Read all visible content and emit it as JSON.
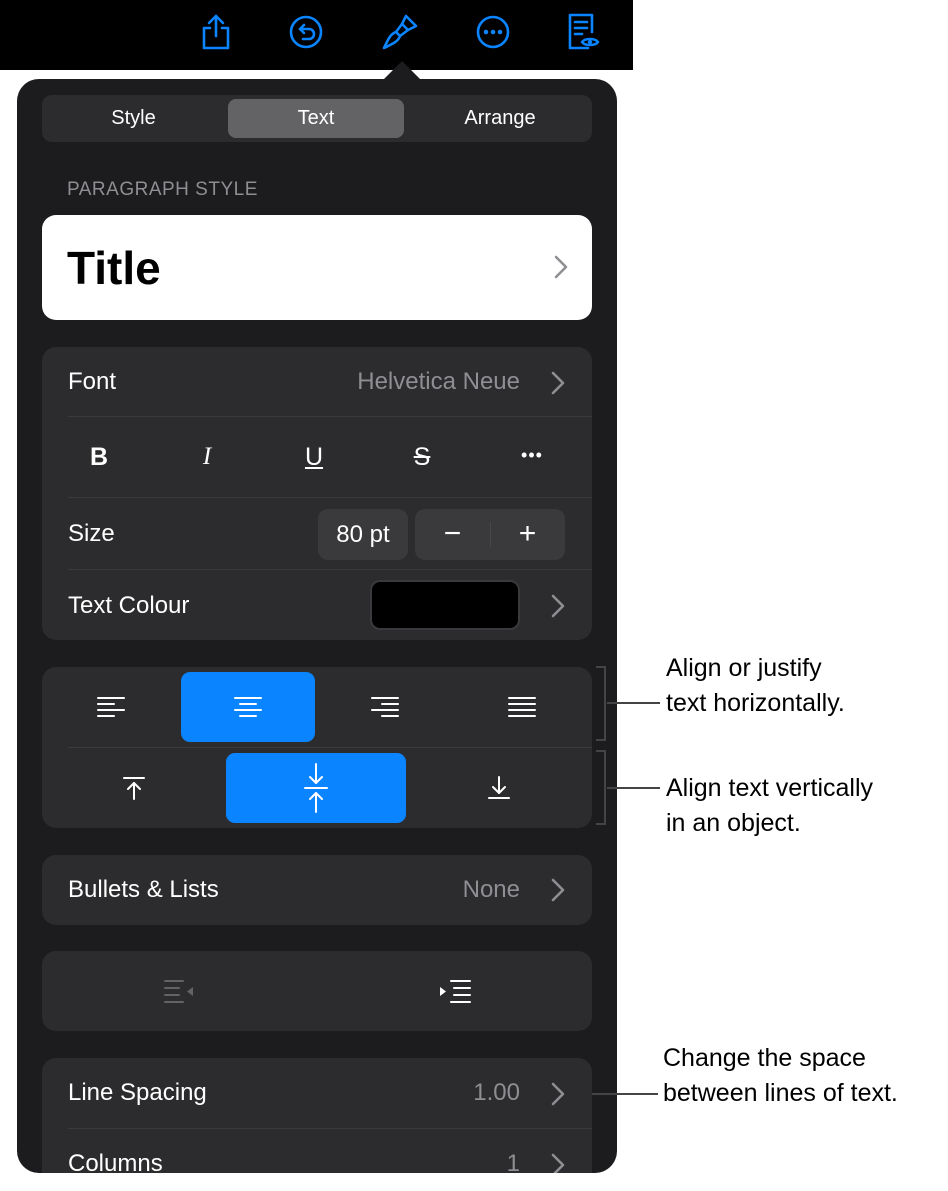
{
  "toolbar": {
    "icons": [
      "share-icon",
      "undo-icon",
      "paintbrush-icon",
      "more-icon",
      "reader-view-icon"
    ],
    "icon_color": "#0a84ff"
  },
  "tabs": [
    {
      "label": "Style",
      "active": false
    },
    {
      "label": "Text",
      "active": true
    },
    {
      "label": "Arrange",
      "active": false
    }
  ],
  "paragraph_style": {
    "section_label": "PARAGRAPH STYLE",
    "value": "Title"
  },
  "font": {
    "label": "Font",
    "value": "Helvetica Neue",
    "buttons": [
      "B",
      "I",
      "U",
      "S",
      "•••"
    ]
  },
  "size": {
    "label": "Size",
    "value": "80 pt",
    "minus": "−",
    "plus": "+"
  },
  "text_colour": {
    "label": "Text Colour",
    "color": "#000000"
  },
  "alignment": {
    "horizontal": [
      "align-left-icon",
      "align-center-icon",
      "align-right-icon",
      "justify-icon"
    ],
    "horizontal_active": 1,
    "vertical": [
      "align-top-icon",
      "align-middle-icon",
      "align-bottom-icon"
    ],
    "vertical_active": 1,
    "accent": "#0a84ff"
  },
  "bullets": {
    "label": "Bullets & Lists",
    "value": "None"
  },
  "indent": [
    "decrease-indent-icon",
    "increase-indent-icon"
  ],
  "line_spacing": {
    "label": "Line Spacing",
    "value": "1.00"
  },
  "columns": {
    "label": "Columns",
    "value": "1"
  },
  "callouts": {
    "horizontal_line1": "Align or justify",
    "horizontal_line2": "text horizontally.",
    "vertical_line1": "Align text vertically",
    "vertical_line2": "in an object.",
    "spacing_line1": "Change the space",
    "spacing_line2": "between lines of text."
  }
}
